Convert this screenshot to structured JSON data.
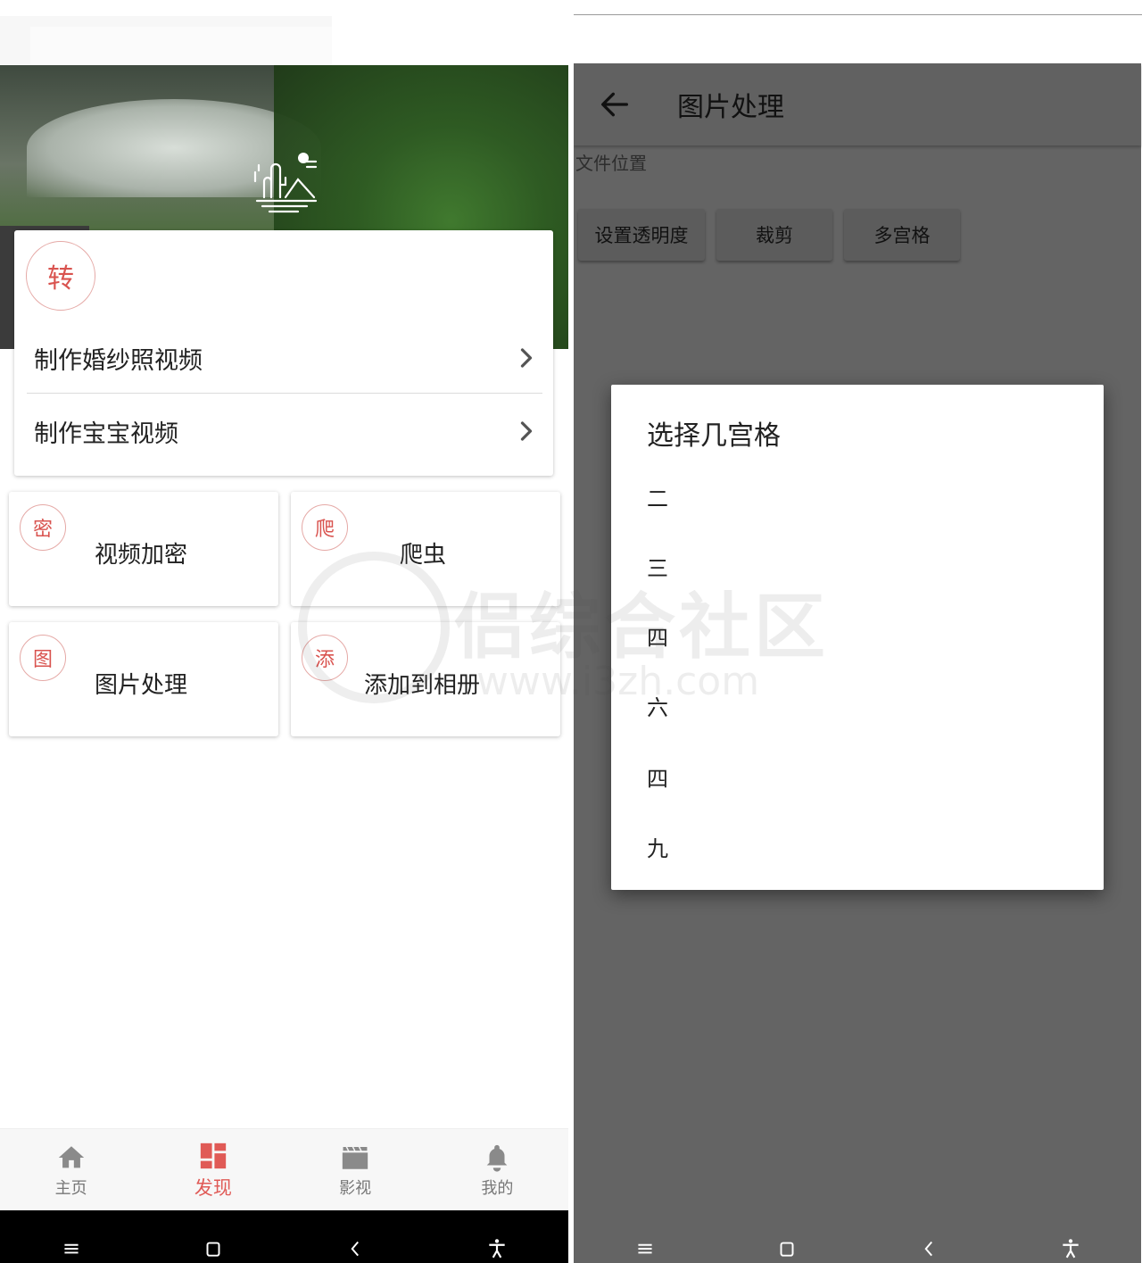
{
  "left": {
    "card": {
      "badge": "转",
      "items": [
        {
          "label": "制作婚纱照视频"
        },
        {
          "label": "制作宝宝视频"
        }
      ]
    },
    "tiles": [
      {
        "badge": "密",
        "label": "视频加密"
      },
      {
        "badge": "爬",
        "label": "爬虫"
      },
      {
        "badge": "图",
        "label": "图片处理"
      },
      {
        "badge": "添",
        "label": "添加到相册"
      }
    ],
    "bottom_nav": [
      {
        "label": "主页",
        "icon": "home-icon",
        "active": false
      },
      {
        "label": "发现",
        "icon": "discover-grid-icon",
        "active": true
      },
      {
        "label": "影视",
        "icon": "clapperboard-icon",
        "active": false
      },
      {
        "label": "我的",
        "icon": "bell-icon",
        "active": false
      }
    ],
    "accent_color": "#e05a56"
  },
  "right": {
    "appbar": {
      "title": "图片处理"
    },
    "file_position_label": "文件位置",
    "buttons": [
      "设置透明度",
      "裁剪",
      "多宫格"
    ],
    "dialog": {
      "title": "选择几宫格",
      "options": [
        "二",
        "三",
        "四",
        "六",
        "四",
        "九"
      ]
    }
  },
  "watermark": {
    "text": "侣综合社区",
    "url": "www.i3zh.com"
  }
}
